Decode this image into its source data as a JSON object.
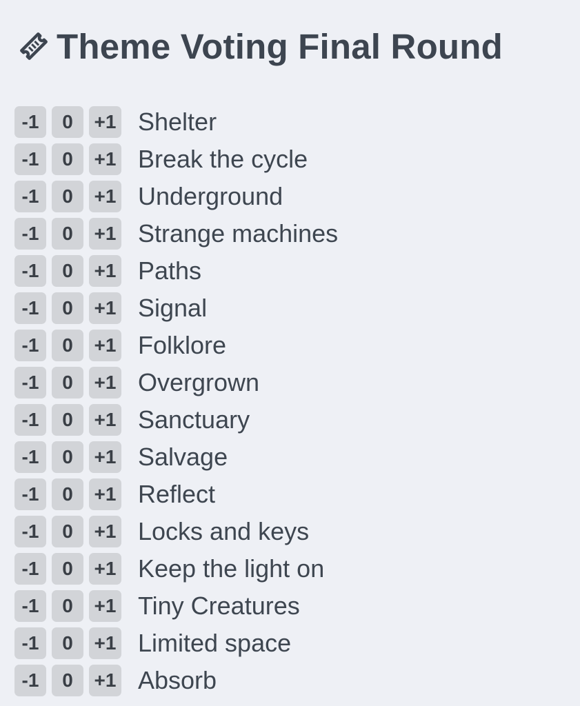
{
  "header": {
    "title": "Theme Voting Final Round",
    "icon": "ticket-icon"
  },
  "vote_options": {
    "minus": "-1",
    "zero": "0",
    "plus": "+1"
  },
  "themes": [
    "Shelter",
    "Break the cycle",
    "Underground",
    "Strange machines",
    "Paths",
    "Signal",
    "Folklore",
    "Overgrown",
    "Sanctuary",
    "Salvage",
    "Reflect",
    "Locks and keys",
    "Keep the light on",
    "Tiny Creatures",
    "Limited space",
    "Absorb"
  ],
  "colors": {
    "background": "#eef0f5",
    "text": "#3d4550",
    "button_bg": "#d2d4d8"
  }
}
